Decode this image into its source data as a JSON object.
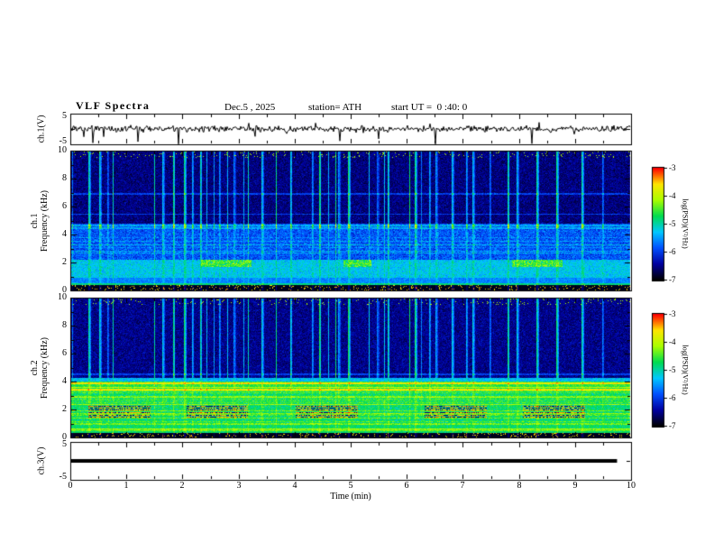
{
  "header": {
    "title": "VLF Spectra",
    "date": "Dec.5 , 2025",
    "station": "station= ATH",
    "start_ut": "start UT =  0 :40: 0"
  },
  "panels": {
    "ch1wave": {
      "ylabel": "ch.1(V)"
    },
    "spec1": {
      "ch": "ch.1",
      "freq": "Frequency (kHz)"
    },
    "spec2": {
      "ch": "ch.2",
      "freq": "Frequency (kHz)"
    },
    "ch3wave": {
      "ylabel": "ch.3(V)"
    }
  },
  "axes": {
    "x": {
      "label": "Time (min)",
      "range_min": [
        0,
        10
      ],
      "tick_labels": [
        "0",
        "1",
        "2",
        "3",
        "4",
        "5",
        "6",
        "7",
        "8",
        "9",
        "10"
      ]
    },
    "spec_y": [
      "10",
      "8",
      "6",
      "4",
      "2",
      "0"
    ],
    "wave_y": [
      "5",
      "-5"
    ]
  },
  "colorbar": {
    "label": "log(PSD)(V²/Hz)",
    "tick_labels": [
      "-3",
      "-4",
      "-5",
      "-6",
      "-7"
    ],
    "value_range": [
      -7,
      -3
    ],
    "colormap_stops": [
      "#000000",
      "#0000a0",
      "#0050ff",
      "#00c8ff",
      "#00dc50",
      "#aaff00",
      "#ffe600",
      "#ff0000"
    ]
  },
  "chart_data": [
    {
      "type": "line",
      "panel": "ch1_waveform",
      "ylabel": "ch.1(V)",
      "ylim": [
        -5,
        5
      ],
      "xlim_min": [
        0,
        10
      ],
      "series": [
        {
          "name": "ch.1 voltage",
          "summary": "broadband noise centered near 0 V, rms about 1 V, frequent impulsive sferic spikes reaching about plus/minus 4 V"
        }
      ]
    },
    {
      "type": "heatmap",
      "panel": "ch1_spectrogram",
      "ylabel": "ch.1 Frequency (kHz)",
      "ylim_khz": [
        0,
        10
      ],
      "xlim_min": [
        0,
        10
      ],
      "value_label": "log(PSD)(V²/Hz)",
      "value_range": [
        -7,
        -3
      ],
      "features": [
        "dark navy background (about -6.5) above ~4.8 kHz pierced by dense full-height vertical sferic streaks (about -5 to -4.5, cyan/green)",
        "blue band about -5.9 between 2.2 and 4.8 kHz with horizontal interference lines near 4.65, 5.5 and 6.95 kHz",
        "cyan band about -5.3 between 0.9 and 2.2 kHz with yellow-green patches near 2 kHz around t = 2.75 and 8.3 min",
        "green line near 0.4 kHz; black band below 0.35 kHz with red speckles",
        "sporadic yellow-green dots along the 10 kHz top edge"
      ]
    },
    {
      "type": "heatmap",
      "panel": "ch2_spectrogram",
      "ylabel": "ch.2 Frequency (kHz)",
      "ylim_khz": [
        0,
        10
      ],
      "xlim_min": [
        0,
        10
      ],
      "value_label": "log(PSD)(V²/Hz)",
      "value_range": [
        -7,
        -3
      ],
      "features": [
        "dark navy background above ~4.3 kHz with the same vertical sferic streaks as ch.1",
        "yellow interference lines near 3.45 and 3.9 kHz and a cyan line near 4.55 kHz",
        "green band about -4.8 below 3.3 kHz crossed by yellow horizontal stripes",
        "dark-red burst patches (about -3.3) between 1.35 and 2.3 kHz around t = 0.85, 2.6, 4.55, 6.85 and 8.6 min",
        "black band below 0.3 kHz with red speckles"
      ]
    },
    {
      "type": "line",
      "panel": "ch3_waveform",
      "ylabel": "ch.3(V)",
      "ylim": [
        -5,
        5
      ],
      "xlim_min": [
        0,
        10
      ],
      "series": [
        {
          "name": "ch.3 voltage",
          "summary": "flat thick black line at 0 V extending from t = 0 to about t = 9.75 min (channel inactive)"
        }
      ]
    }
  ]
}
